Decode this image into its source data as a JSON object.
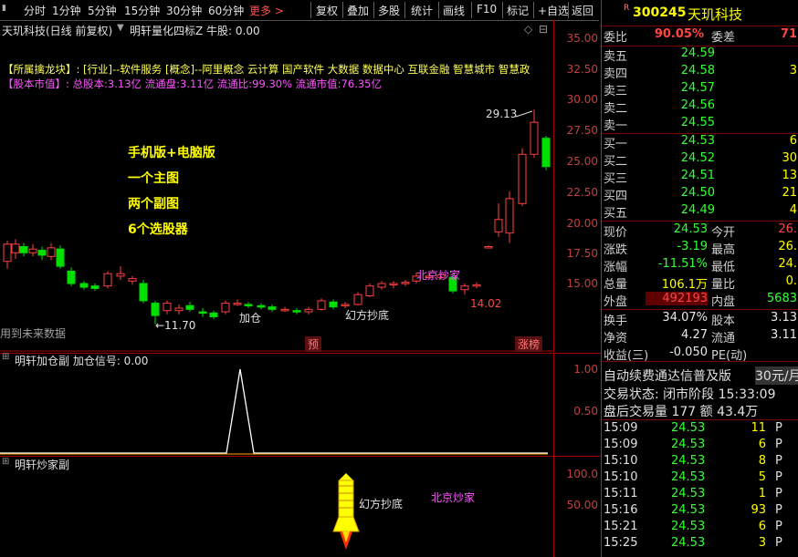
{
  "toolbar": {
    "items": [
      "分时",
      "1分钟",
      "5分钟",
      "15分钟",
      "30分钟",
      "60分钟"
    ],
    "more": "更多 >",
    "tools": [
      "复权",
      "叠加",
      "多股",
      "统计",
      "画线",
      "F10",
      "标记",
      "+自选",
      "返回"
    ]
  },
  "main": {
    "title": "天玑科技(日线 前复权)",
    "indicator": "明轩量化四标Z 牛股: 0.00",
    "concept_label": "【所属擒龙块】:",
    "concept_text": "[行业]--软件服务 [概念]--阿里概念 云计算 国产软件 大数据 数据中心 互联金融 智慧城市 智慧政",
    "capital_label": "【股本市值】:",
    "capital_text": "总股本:3.13亿 流通盘:3.11亿 流通比:99.30% 流通市值:76.35亿",
    "promo": [
      "手机版+电脑版",
      "一个主图",
      "两个副图",
      "6个选股器"
    ],
    "future_note": "用到未来数据",
    "high_label": "29.13",
    "low_label": "←11.70",
    "right_low_label": "14.02",
    "add_position": "加仓",
    "fangfang": "幻方抄底",
    "beijing": "北京炒家",
    "tag_yu": "预",
    "tag_zhangting": "涨榜",
    "y_ticks": [
      "35.00",
      "32.50",
      "30.00",
      "27.50",
      "25.00",
      "22.50",
      "20.00",
      "17.50",
      "15.00"
    ]
  },
  "sub1": {
    "title": "明轩加仓副 加仓信号: 0.00",
    "y_ticks": [
      "1.00",
      "0.50"
    ]
  },
  "sub2": {
    "title": "明轩炒家副",
    "y_ticks": [
      "100.0",
      "50.00"
    ],
    "fangfang": "幻方抄底",
    "beijing": "北京炒家"
  },
  "quote": {
    "code": "300245",
    "name": "天玑科技",
    "weibi_label": "委比",
    "weibi": "90.05%",
    "weicha_label": "委差",
    "weicha": "71",
    "asks": [
      {
        "label": "卖五",
        "price": "24.59",
        "vol": ""
      },
      {
        "label": "卖四",
        "price": "24.58",
        "vol": "3"
      },
      {
        "label": "卖三",
        "price": "24.57",
        "vol": ""
      },
      {
        "label": "卖二",
        "price": "24.56",
        "vol": ""
      },
      {
        "label": "卖一",
        "price": "24.55",
        "vol": ""
      }
    ],
    "bids": [
      {
        "label": "买一",
        "price": "24.53",
        "vol": "6"
      },
      {
        "label": "买二",
        "price": "24.52",
        "vol": "30"
      },
      {
        "label": "买三",
        "price": "24.51",
        "vol": "13"
      },
      {
        "label": "买四",
        "price": "24.50",
        "vol": "21"
      },
      {
        "label": "买五",
        "price": "24.49",
        "vol": "4"
      }
    ],
    "stats": [
      {
        "l1": "现价",
        "v1": "24.53",
        "l2": "今开",
        "v2": "26."
      },
      {
        "l1": "涨跌",
        "v1": "-3.19",
        "l2": "最高",
        "v2": "26."
      },
      {
        "l1": "涨幅",
        "v1": "-11.51%",
        "l2": "最低",
        "v2": "24."
      },
      {
        "l1": "总量",
        "v1": "106.1万",
        "l2": "量比",
        "v2": "0."
      },
      {
        "l1": "外盘",
        "v1": "492193",
        "l2": "内盘",
        "v2": "5683"
      }
    ],
    "stats2": [
      {
        "l1": "换手",
        "v1": "34.07%",
        "l2": "股本",
        "v2": "3.13"
      },
      {
        "l1": "净资",
        "v1": "4.27",
        "l2": "流通",
        "v2": "3.11"
      },
      {
        "l1": "收益(三)",
        "v1": "-0.050",
        "l2": "PE(动)",
        "v2": ""
      }
    ],
    "ad": "自动续费通达信普及版",
    "ad_price": "30元/月",
    "status_line": "交易状态: 闭市阶段 15:33:09",
    "after_hours": "盘后交易量 177 额 43.4万",
    "trades": [
      {
        "t": "15:09",
        "p": "24.53",
        "v": "11",
        "s": "P"
      },
      {
        "t": "15:09",
        "p": "24.53",
        "v": "6",
        "s": "P"
      },
      {
        "t": "15:10",
        "p": "24.53",
        "v": "8",
        "s": "P"
      },
      {
        "t": "15:10",
        "p": "24.53",
        "v": "5",
        "s": "P"
      },
      {
        "t": "15:11",
        "p": "24.53",
        "v": "1",
        "s": "P"
      },
      {
        "t": "15:16",
        "p": "24.53",
        "v": "93",
        "s": "P"
      },
      {
        "t": "15:21",
        "p": "24.53",
        "v": "6",
        "s": "P"
      },
      {
        "t": "15:25",
        "p": "24.53",
        "v": "3",
        "s": "P"
      }
    ]
  },
  "colors": {
    "up": "#ff4040",
    "down": "#00e000",
    "axis": "#c04040",
    "line": "#a00000"
  }
}
